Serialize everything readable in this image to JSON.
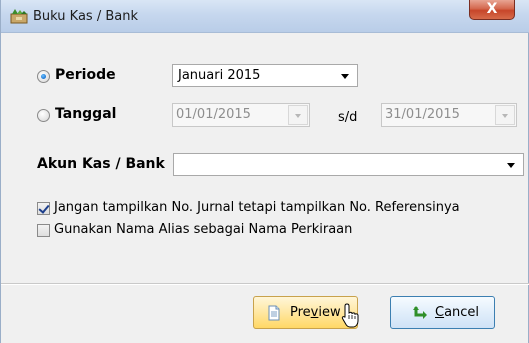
{
  "window": {
    "title": "Buku Kas / Bank",
    "close_glyph": "X"
  },
  "periode": {
    "label": "Periode",
    "selected": true,
    "value": "Januari 2015"
  },
  "tanggal": {
    "label": "Tanggal",
    "selected": false,
    "from": "01/01/2015",
    "separator": "s/d",
    "to": "31/01/2015"
  },
  "akun": {
    "label": "Akun Kas / Bank",
    "value": ""
  },
  "options": [
    {
      "label": "Jangan tampilkan No. Jurnal tetapi tampilkan No. Referensinya",
      "checked": true
    },
    {
      "label": "Gunakan Nama Alias sebagai Nama Perkiraan",
      "checked": false
    }
  ],
  "buttons": {
    "preview": {
      "label_pre": "Pre",
      "label_mnemonic": "v",
      "label_post": "iew",
      "icon": "document-icon"
    },
    "cancel": {
      "label_mnemonic": "C",
      "label_post": "ancel",
      "icon": "undo-arrow-icon"
    }
  },
  "colors": {
    "titlebar": "#c6d7ee",
    "close": "#c7462a",
    "radio_selected": "#1a74d1",
    "preview_btn": "#ffe7a2",
    "cancel_btn": "#e1eefb"
  }
}
